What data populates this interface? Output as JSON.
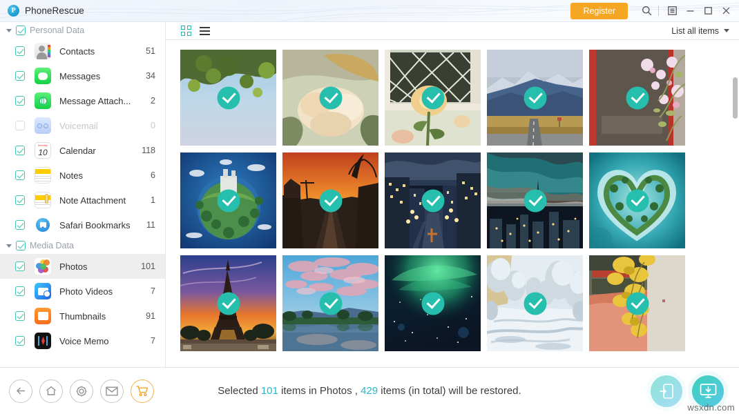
{
  "titlebar": {
    "brand": "PhoneRescue",
    "logo_letter": "P",
    "register_label": "Register",
    "icons": {
      "search": "search-icon",
      "panel": "panel-toggle-icon",
      "minimize": "minimize-icon",
      "maximize": "maximize-icon",
      "close": "close-icon"
    }
  },
  "sidebar": {
    "groups": [
      {
        "label": "Personal Data",
        "checked": true,
        "expanded": true,
        "items": [
          {
            "label": "Contacts",
            "count": "51",
            "checked": true,
            "icon": "contacts-icon",
            "enabled": true
          },
          {
            "label": "Messages",
            "count": "34",
            "checked": true,
            "icon": "messages-icon",
            "enabled": true
          },
          {
            "label": "Message Attach...",
            "count": "2",
            "checked": true,
            "icon": "message-attachment-icon",
            "enabled": true
          },
          {
            "label": "Voicemail",
            "count": "0",
            "checked": false,
            "icon": "voicemail-icon",
            "enabled": false
          },
          {
            "label": "Calendar",
            "count": "118",
            "checked": true,
            "icon": "calendar-icon",
            "enabled": true
          },
          {
            "label": "Notes",
            "count": "6",
            "checked": true,
            "icon": "notes-icon",
            "enabled": true
          },
          {
            "label": "Note Attachment",
            "count": "1",
            "checked": true,
            "icon": "note-attachment-icon",
            "enabled": true
          },
          {
            "label": "Safari Bookmarks",
            "count": "11",
            "checked": true,
            "icon": "safari-bookmarks-icon",
            "enabled": true
          }
        ]
      },
      {
        "label": "Media Data",
        "checked": true,
        "expanded": true,
        "items": [
          {
            "label": "Photos",
            "count": "101",
            "checked": true,
            "icon": "photos-icon",
            "enabled": true,
            "selected": true
          },
          {
            "label": "Photo Videos",
            "count": "7",
            "checked": true,
            "icon": "photo-videos-icon",
            "enabled": true
          },
          {
            "label": "Thumbnails",
            "count": "91",
            "checked": true,
            "icon": "thumbnails-icon",
            "enabled": true
          },
          {
            "label": "Voice Memo",
            "count": "7",
            "checked": true,
            "icon": "voice-memo-icon",
            "enabled": true
          }
        ]
      }
    ]
  },
  "main": {
    "toolbar": {
      "grid_view_icon": "grid-view-icon",
      "list_view_icon": "list-view-icon",
      "active_view": "grid",
      "filter_label": "List all items"
    },
    "photos": [
      {
        "alt": "tree-canopy-sky",
        "selected": true
      },
      {
        "alt": "dried-white-flowers",
        "selected": true
      },
      {
        "alt": "rose-by-window",
        "selected": true
      },
      {
        "alt": "mountain-road",
        "selected": true
      },
      {
        "alt": "blossom-red-wall",
        "selected": true
      },
      {
        "alt": "tiny-planet-castle",
        "selected": true
      },
      {
        "alt": "palm-street-sunset",
        "selected": true
      },
      {
        "alt": "city-street-night",
        "selected": true
      },
      {
        "alt": "city-skyline-dusk",
        "selected": true
      },
      {
        "alt": "heart-island-lagoon",
        "selected": true
      },
      {
        "alt": "eiffel-tower-sunset",
        "selected": true
      },
      {
        "alt": "lake-reflection-sky",
        "selected": true
      },
      {
        "alt": "aurora-green-sky",
        "selected": true
      },
      {
        "alt": "snow-forest-path",
        "selected": true
      },
      {
        "alt": "ginkgo-yellow-leaves",
        "selected": true
      }
    ]
  },
  "footer": {
    "tools": [
      {
        "icon": "back-arrow-icon",
        "name": "back-button"
      },
      {
        "icon": "home-icon",
        "name": "home-button"
      },
      {
        "icon": "gear-icon",
        "name": "settings-button"
      },
      {
        "icon": "mail-icon",
        "name": "feedback-button"
      },
      {
        "icon": "cart-icon",
        "name": "store-button"
      }
    ],
    "status": {
      "prefix": "Selected ",
      "selected_count": "101",
      "middle": " items in Photos , ",
      "total_count": "429",
      "suffix": " items (in total) will be restored."
    },
    "restore_to_device_label": "restore-to-device-icon",
    "restore_to_computer_label": "restore-to-computer-icon",
    "watermark": "wsxdn.com"
  },
  "colors": {
    "accent_teal": "#26bfae",
    "register_orange": "#f5a623",
    "status_blue": "#2bb6c9",
    "selected_row": "#eeeeee"
  }
}
